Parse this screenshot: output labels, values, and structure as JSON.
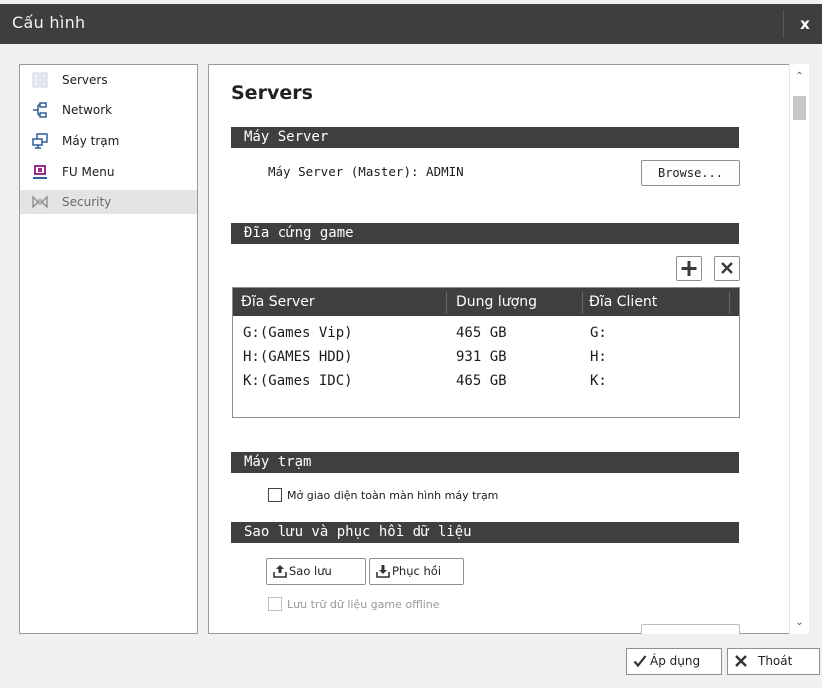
{
  "window": {
    "title": "Cấu hình",
    "close_label": "x"
  },
  "sidebar": {
    "items": [
      {
        "label": "Servers",
        "icon": "servers-icon"
      },
      {
        "label": "Network",
        "icon": "network-icon"
      },
      {
        "label": "Máy trạm",
        "icon": "workstation-icon"
      },
      {
        "label": "FU Menu",
        "icon": "menu-icon"
      },
      {
        "label": "Security",
        "icon": "security-icon",
        "active": true
      }
    ]
  },
  "main": {
    "heading": "Servers",
    "server_section": {
      "title": "Máy Server",
      "server_line": "Máy Server (Master): ADMIN",
      "browse_label": "Browse..."
    },
    "disk_section": {
      "title": "Đĩa cứng game",
      "add_icon": "plus-icon",
      "remove_icon": "x-icon",
      "columns": [
        "Đĩa Server",
        "Dung lượng",
        "Đĩa Client"
      ],
      "rows": [
        [
          "G:(Games Vip)",
          "465 GB",
          "G:"
        ],
        [
          "H:(GAMES HDD)",
          "931 GB",
          "H:"
        ],
        [
          "K:(Games IDC)",
          "465 GB",
          "K:"
        ]
      ]
    },
    "workstation_section": {
      "title": "Máy trạm",
      "fullscreen_label": "Mở giao diện toàn màn hình máy trạm",
      "fullscreen_checked": false
    },
    "backup_section": {
      "title": "Sao lưu và phục hồi dữ liệu",
      "backup_label": "Sao lưu",
      "restore_label": "Phục hồi",
      "offline_label": "Lưu trữ dữ liệu game offline",
      "offline_checked": false,
      "offline_enabled": false
    }
  },
  "footer": {
    "apply_label": "Áp dụng",
    "exit_label": "Thoát"
  },
  "colors": {
    "title_bar": "#3e3e3e",
    "section_bar": "#3f3f3f",
    "accent_blue": "#2f5f9a",
    "icon_purple": "#9b2f8e"
  }
}
